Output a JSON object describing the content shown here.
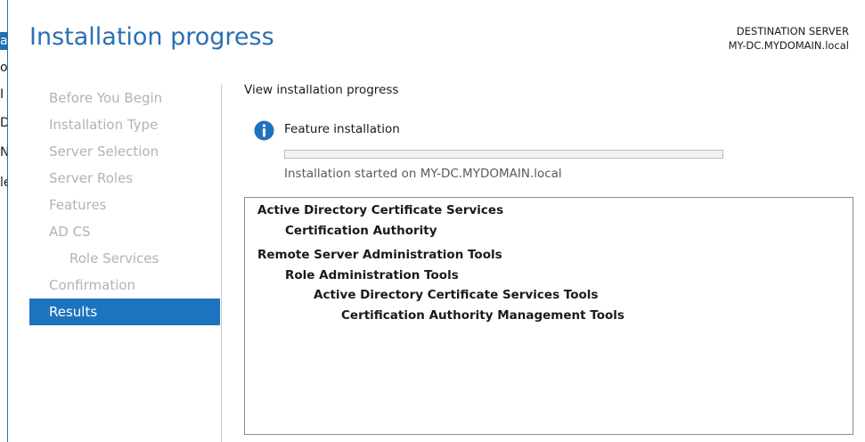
{
  "background_window": {
    "edge_chars": [
      "a",
      "o",
      "I",
      "D",
      "N",
      "le"
    ]
  },
  "page": {
    "title": "Installation progress",
    "destination_label": "DESTINATION SERVER",
    "destination_server": "MY-DC.MYDOMAIN.local"
  },
  "nav": {
    "items": [
      {
        "label": "Before You Begin"
      },
      {
        "label": "Installation Type"
      },
      {
        "label": "Server Selection"
      },
      {
        "label": "Server Roles"
      },
      {
        "label": "Features"
      },
      {
        "label": "AD CS"
      },
      {
        "label": "Role Services"
      },
      {
        "label": "Confirmation"
      },
      {
        "label": "Results"
      }
    ],
    "active": "Results"
  },
  "content": {
    "heading": "View installation progress",
    "status_icon": "info-icon",
    "feature_label": "Feature installation",
    "progress_percent": 0,
    "started_text": "Installation started on MY-DC.MYDOMAIN.local",
    "results": [
      {
        "label": "Active Directory Certificate Services",
        "level": 0
      },
      {
        "label": "Certification Authority",
        "level": 1
      },
      {
        "label": "Remote Server Administration Tools",
        "level": 0
      },
      {
        "label": "Role Administration Tools",
        "level": 1
      },
      {
        "label": "Active Directory Certificate Services Tools",
        "level": 2
      },
      {
        "label": "Certification Authority Management Tools",
        "level": 3
      }
    ]
  },
  "colors": {
    "accent": "#1e73be",
    "title": "#2a6fb4",
    "info_icon": "#1e73be"
  }
}
